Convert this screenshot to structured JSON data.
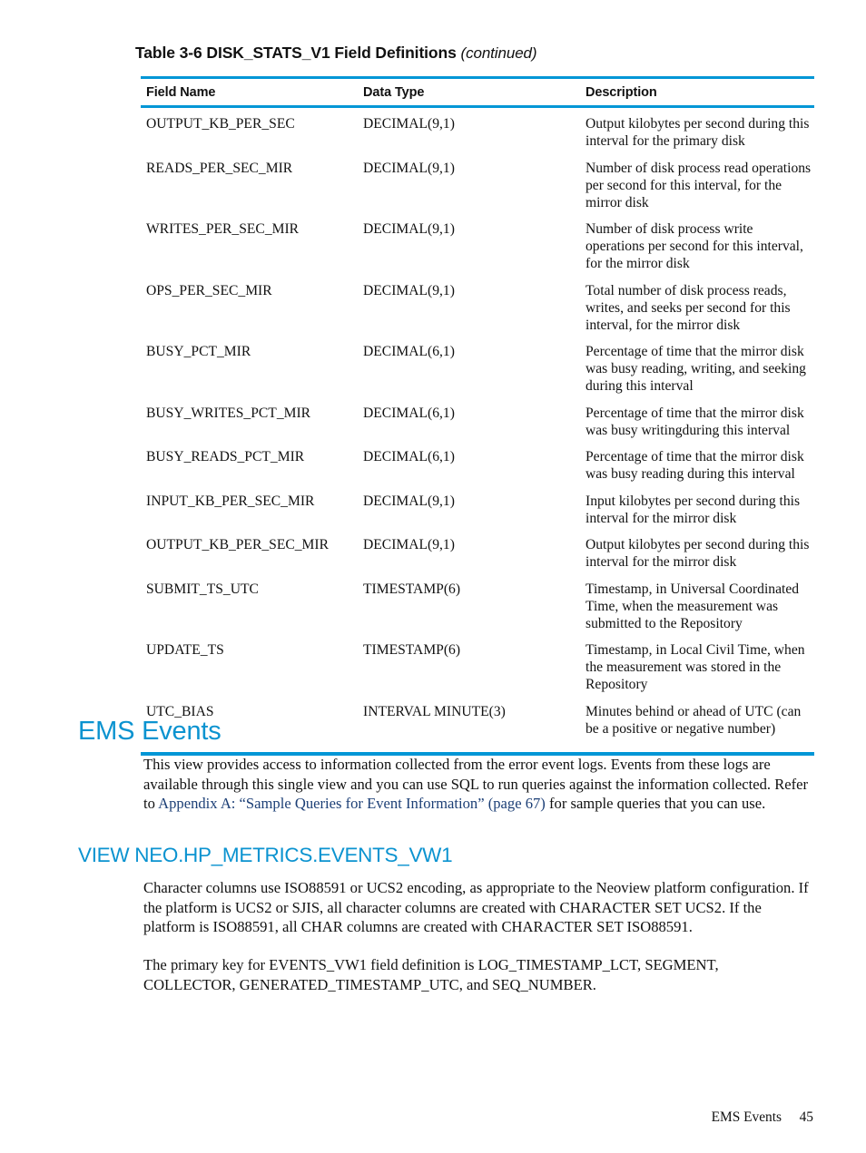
{
  "document": {
    "table": {
      "caption_main": "Table 3-6 DISK_STATS_V1 Field Definitions",
      "caption_continued": "(continued)",
      "columns": [
        "Field Name",
        "Data Type",
        "Description"
      ],
      "rows": [
        {
          "field": "OUTPUT_KB_PER_SEC",
          "type": "DECIMAL(9,1)",
          "description": "Output kilobytes per second during this interval for the primary disk"
        },
        {
          "field": "READS_PER_SEC_MIR",
          "type": "DECIMAL(9,1)",
          "description": "Number of disk process read operations per second for this interval, for the mirror disk"
        },
        {
          "field": "WRITES_PER_SEC_MIR",
          "type": "DECIMAL(9,1)",
          "description": "Number of disk process write operations per second for this interval, for the mirror disk"
        },
        {
          "field": "OPS_PER_SEC_MIR",
          "type": "DECIMAL(9,1)",
          "description": "Total number of disk process reads, writes, and seeks per second for this interval, for the mirror disk"
        },
        {
          "field": "BUSY_PCT_MIR",
          "type": "DECIMAL(6,1)",
          "description": "Percentage of time that the mirror disk was busy reading, writing, and seeking during this interval"
        },
        {
          "field": "BUSY_WRITES_PCT_MIR",
          "type": "DECIMAL(6,1)",
          "description": "Percentage of time that the mirror disk was busy writingduring this interval"
        },
        {
          "field": "BUSY_READS_PCT_MIR",
          "type": "DECIMAL(6,1)",
          "description": "Percentage of time that the mirror disk was busy reading during this interval"
        },
        {
          "field": "INPUT_KB_PER_SEC_MIR",
          "type": "DECIMAL(9,1)",
          "description": "Input kilobytes per second during this interval for the mirror disk"
        },
        {
          "field": "OUTPUT_KB_PER_SEC_MIR",
          "type": "DECIMAL(9,1)",
          "description": "Output kilobytes per second during this interval for the mirror disk"
        },
        {
          "field": "SUBMIT_TS_UTC",
          "type": "TIMESTAMP(6)",
          "description": "Timestamp, in Universal Coordinated Time, when the measurement was submitted to the Repository"
        },
        {
          "field": "UPDATE_TS",
          "type": "TIMESTAMP(6)",
          "description": "Timestamp, in Local Civil Time, when the measurement was stored in the Repository"
        },
        {
          "field": "UTC_BIAS",
          "type": "INTERVAL MINUTE(3)",
          "description": "Minutes behind or ahead of UTC (can be a positive or negative number)"
        }
      ]
    },
    "section_ems": {
      "heading": "EMS Events",
      "paragraph_lead": "This view provides access to information collected from the error event logs. Events from these logs are available through this single view and you can use SQL to run queries against the information collected. Refer to ",
      "paragraph_link": "Appendix A: “Sample Queries for Event Information” (page 67)",
      "paragraph_tail": " for sample queries that you can use."
    },
    "section_view": {
      "heading": "VIEW NEO.HP_METRICS.EVENTS_VW1",
      "paragraph_1": "Character columns use ISO88591 or UCS2 encoding, as appropriate to the Neoview platform configuration. If the platform is UCS2 or SJIS, all character columns are created with CHARACTER SET UCS2. If the platform is ISO88591, all CHAR columns are created with CHARACTER SET ISO88591.",
      "paragraph_2": "The primary key for EVENTS_VW1 field definition is LOG_TIMESTAMP_LCT, SEGMENT, COLLECTOR, GENERATED_TIMESTAMP_UTC, and SEQ_NUMBER."
    },
    "footer": {
      "section_title": "EMS Events",
      "page_number": "45"
    },
    "colors": {
      "rule_blue": "#0096d6",
      "heading_blue": "#0b93d0",
      "link_navy": "#1c3f76",
      "body_text": "#111111"
    }
  }
}
